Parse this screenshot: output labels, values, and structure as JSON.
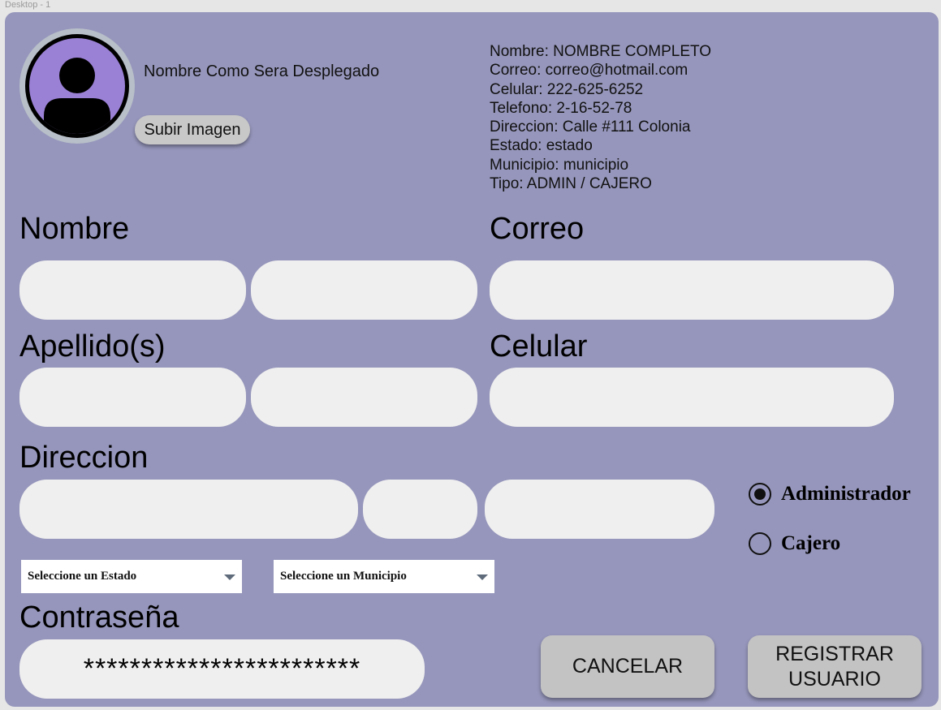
{
  "window": {
    "title": "Desktop - 1"
  },
  "profile": {
    "display_name": "Nombre Como Sera Desplegado",
    "upload_label": "Subir Imagen"
  },
  "info_panel": [
    "Nombre: NOMBRE COMPLETO",
    "Correo: correo@hotmail.com",
    "Celular: 222-625-6252",
    "Telefono: 2-16-52-78",
    "Direccion: Calle #111 Colonia",
    "Estado: estado",
    "Municipio: municipio",
    "Tipo: ADMIN / CAJERO"
  ],
  "form": {
    "nombre_label": "Nombre",
    "correo_label": "Correo",
    "apellidos_label": "Apellido(s)",
    "celular_label": "Celular",
    "direccion_label": "Direccion",
    "estado_select": "Seleccione un Estado",
    "municipio_select": "Seleccione un Municipio",
    "password_label": "Contraseña",
    "password_value": "************************"
  },
  "role": {
    "options": [
      {
        "label": "Administrador",
        "selected": true
      },
      {
        "label": "Cajero",
        "selected": false
      }
    ]
  },
  "actions": {
    "cancel_label": "CANCELAR",
    "register_label": "REGISTRAR USUARIO"
  },
  "colors": {
    "card_bg": "#9696bc",
    "field_bg": "#efefef",
    "avatar_fill": "#9b81d6",
    "button_bg": "#c3c3c3"
  }
}
